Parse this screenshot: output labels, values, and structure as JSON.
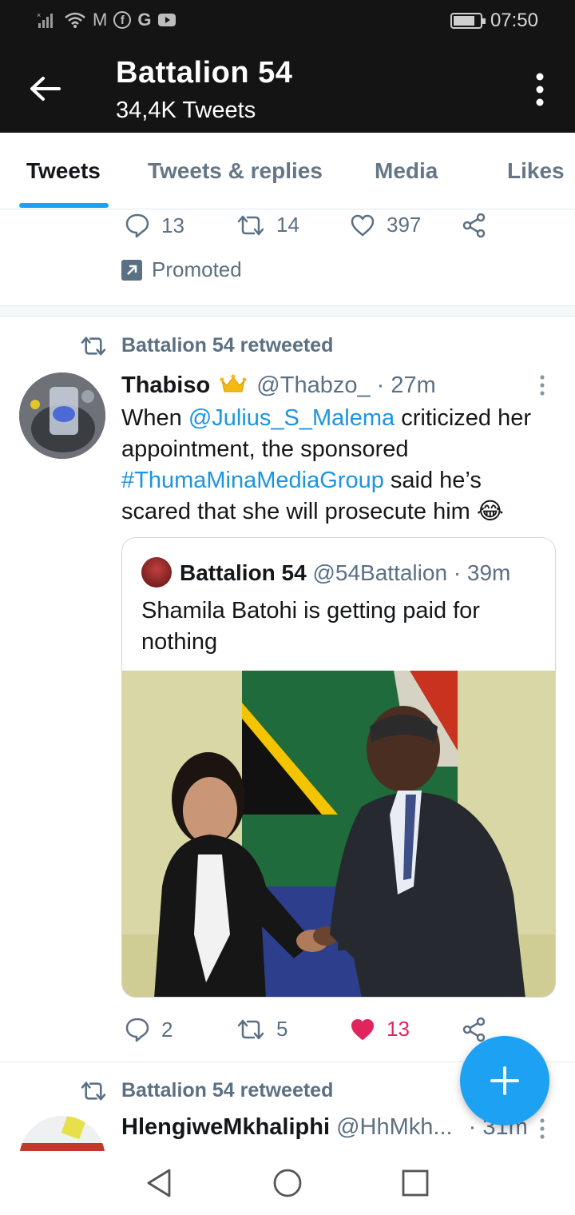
{
  "status_bar": {
    "time": "07:50",
    "left_icons": [
      "signal-icon",
      "wifi-icon",
      "gmail-icon",
      "facebook-icon",
      "google-icon",
      "youtube-icon"
    ],
    "gmail_glyph": "M",
    "facebook_glyph": "f",
    "google_glyph": "G"
  },
  "header": {
    "title": "Battalion 54",
    "subtitle": "34,4K Tweets"
  },
  "tabs": [
    {
      "label": "Tweets",
      "active": true
    },
    {
      "label": "Tweets & replies",
      "active": false
    },
    {
      "label": "Media",
      "active": false
    },
    {
      "label": "Likes",
      "active": false
    }
  ],
  "promoted_tweet": {
    "replies": "13",
    "retweets": "14",
    "likes": "397",
    "promoted_label": "Promoted"
  },
  "tweet1": {
    "retweet_label": "Battalion 54 retweeted",
    "display_name": "Thabiso",
    "handle": "@Thabzo_",
    "time": "· 27m",
    "text_prefix": "When ",
    "mention": "@Julius_S_Malema",
    "text_middle": " criticized her appointment, the sponsored ",
    "hashtag": "#ThumaMinaMediaGroup",
    "text_suffix": " said he’s scared that she will prosecute him 😂",
    "quote": {
      "display_name": "Battalion 54",
      "handle": "@54Battalion",
      "time": "· 39m",
      "text": "Shamila Batohi is getting paid for nothing"
    },
    "replies": "2",
    "retweets": "5",
    "likes": "13",
    "liked": true,
    "like_color": "#e0245e"
  },
  "tweet2": {
    "retweet_label": "Battalion 54 retweeted",
    "display_name": "HlengiweMkhaliphi",
    "handle": "@HhMkh...",
    "time": "· 31m"
  },
  "colors": {
    "accent": "#1da1f2",
    "link": "#1b95e0",
    "header_bg": "#141414"
  }
}
